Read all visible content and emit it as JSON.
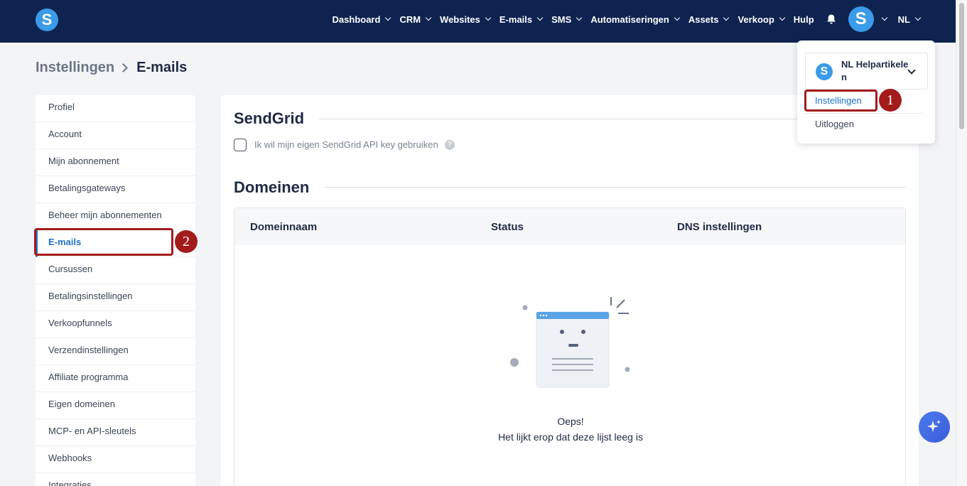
{
  "topbar": {
    "logo_letter": "S",
    "nav": [
      {
        "label": "Dashboard",
        "has_menu": true
      },
      {
        "label": "CRM",
        "has_menu": true
      },
      {
        "label": "Websites",
        "has_menu": true
      },
      {
        "label": "E-mails",
        "has_menu": true
      },
      {
        "label": "SMS",
        "has_menu": true
      },
      {
        "label": "Automatiseringen",
        "has_menu": true
      },
      {
        "label": "Assets",
        "has_menu": true
      },
      {
        "label": "Verkoop",
        "has_menu": true
      },
      {
        "label": "Hulp",
        "has_menu": false
      }
    ],
    "bell_icon": "bell-icon",
    "avatar_letter": "S",
    "language": "NL",
    "background_color": "#0f2350"
  },
  "breadcrumb": {
    "parent": "Instellingen",
    "current": "E-mails"
  },
  "sidebar": {
    "items": [
      {
        "label": "Profiel"
      },
      {
        "label": "Account"
      },
      {
        "label": "Mijn abonnement"
      },
      {
        "label": "Betalingsgateways"
      },
      {
        "label": "Beheer mijn abonnementen"
      },
      {
        "label": "E-mails",
        "active": true
      },
      {
        "label": "Cursussen"
      },
      {
        "label": "Betalingsinstellingen"
      },
      {
        "label": "Verkoopfunnels"
      },
      {
        "label": "Verzendinstellingen"
      },
      {
        "label": "Affiliate programma"
      },
      {
        "label": "Eigen domeinen"
      },
      {
        "label": "MCP- en API-sleutels"
      },
      {
        "label": "Webhooks"
      },
      {
        "label": "Integraties"
      }
    ],
    "active_color": "#1d72c9"
  },
  "main": {
    "sendgrid": {
      "title": "SendGrid",
      "checkbox_label": "Ik wil mijn eigen SendGrid API key gebruiken",
      "checked": false,
      "help_icon": "question-icon"
    },
    "domains": {
      "title": "Domeinen",
      "columns": [
        "Domeinnaam",
        "Status",
        "DNS instellingen"
      ],
      "empty_title": "Oeps!",
      "empty_subtitle": "Het lijkt erop dat deze lijst leeg is"
    }
  },
  "dropdown": {
    "account_name": "NL Helpartikelen",
    "account_logo_letter": "S",
    "items": [
      "Instellingen",
      "Uitloggen"
    ],
    "link_color": "#1d72c9"
  },
  "annotations": {
    "marker_color": "#a31b1b",
    "badges": [
      "1",
      "2"
    ]
  },
  "fab": {
    "icon": "sparkle-icon"
  }
}
